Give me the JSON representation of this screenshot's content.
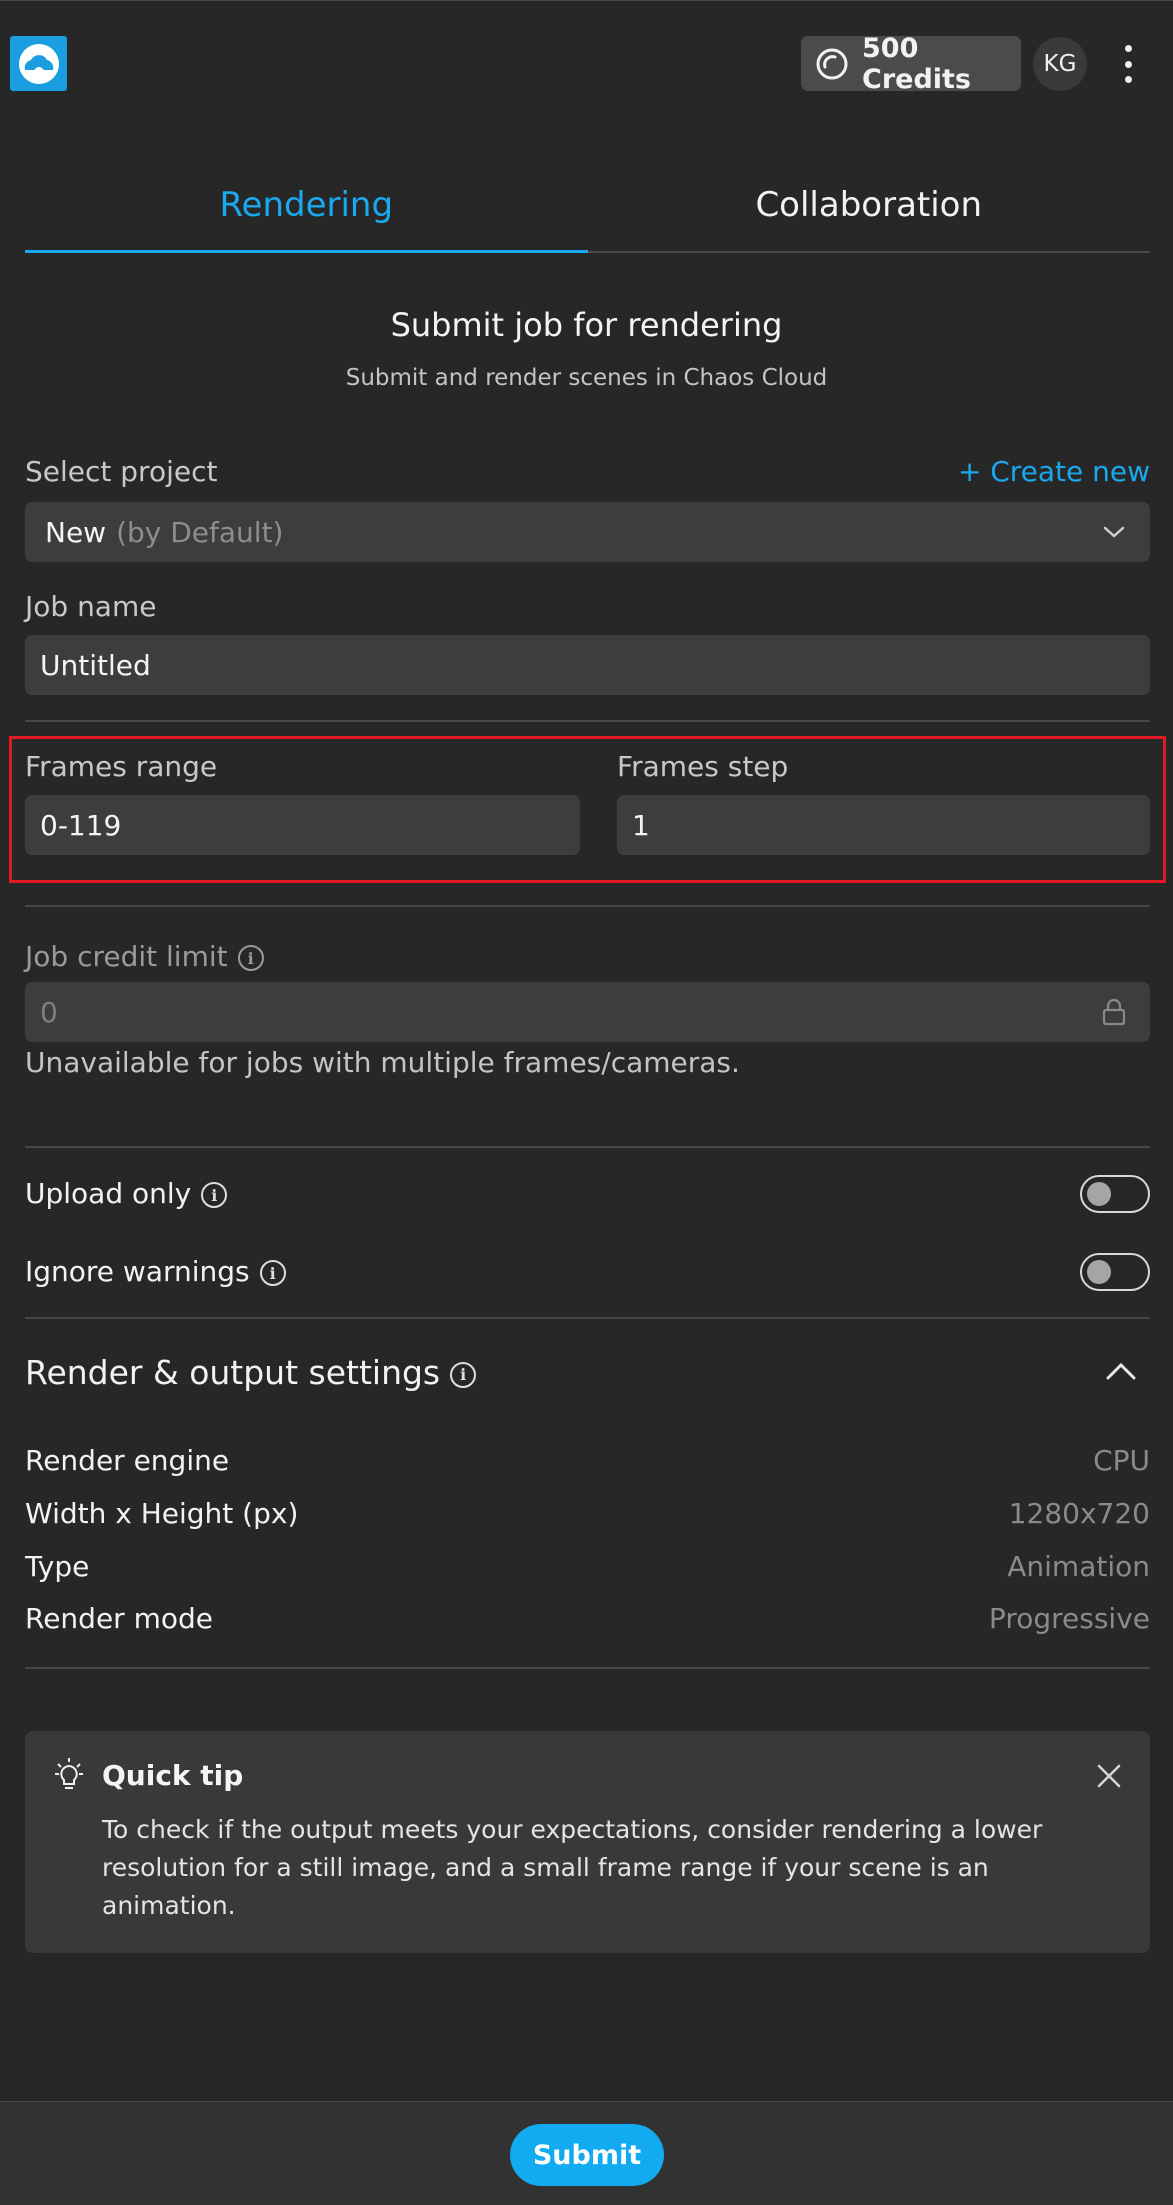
{
  "header": {
    "logo_icon": "cloud-logo-icon",
    "credits_icon": "credits-icon",
    "credits_label": "500 Credits",
    "avatar_initials": "KG",
    "menu_icon": "more-vertical-icon"
  },
  "tabs": [
    {
      "label": "Rendering",
      "active": true
    },
    {
      "label": "Collaboration",
      "active": false
    }
  ],
  "section": {
    "title": "Submit job for rendering",
    "subtitle": "Submit and render scenes in Chaos Cloud"
  },
  "project": {
    "label": "Select project",
    "create_link": "+ Create new",
    "selected_value": "New",
    "selected_suffix": "(by Default)",
    "dropdown_icon": "chevron-down-icon"
  },
  "job_name": {
    "label": "Job name",
    "value": "Untitled"
  },
  "frames": {
    "range_label": "Frames range",
    "range_value": "0-119",
    "step_label": "Frames step",
    "step_value": "1"
  },
  "credit_limit": {
    "label": "Job credit limit",
    "value": "0",
    "lock_icon": "lock-icon",
    "note": "Unavailable for jobs with multiple frames/cameras."
  },
  "toggles": {
    "upload_only": {
      "label": "Upload only",
      "on": false
    },
    "ignore_warnings": {
      "label": "Ignore warnings",
      "on": false
    }
  },
  "render_settings": {
    "title": "Render & output settings",
    "collapse_icon": "chevron-up-icon",
    "rows": [
      {
        "label": "Render engine",
        "value": "CPU"
      },
      {
        "label": "Width x Height (px)",
        "value": "1280x720"
      },
      {
        "label": "Type",
        "value": "Animation"
      },
      {
        "label": "Render mode",
        "value": "Progressive"
      }
    ]
  },
  "tip": {
    "icon": "lightbulb-icon",
    "title": "Quick tip",
    "body": "To check if the output meets your expectations, consider rendering a lower resolution for a still image, and a small frame range if your scene is an animation.",
    "close_icon": "close-icon"
  },
  "footer": {
    "submit_label": "Submit"
  },
  "colors": {
    "accent": "#1aa8ee",
    "background": "#272727",
    "field": "#3d3d3d",
    "highlight": "#e01a22"
  }
}
